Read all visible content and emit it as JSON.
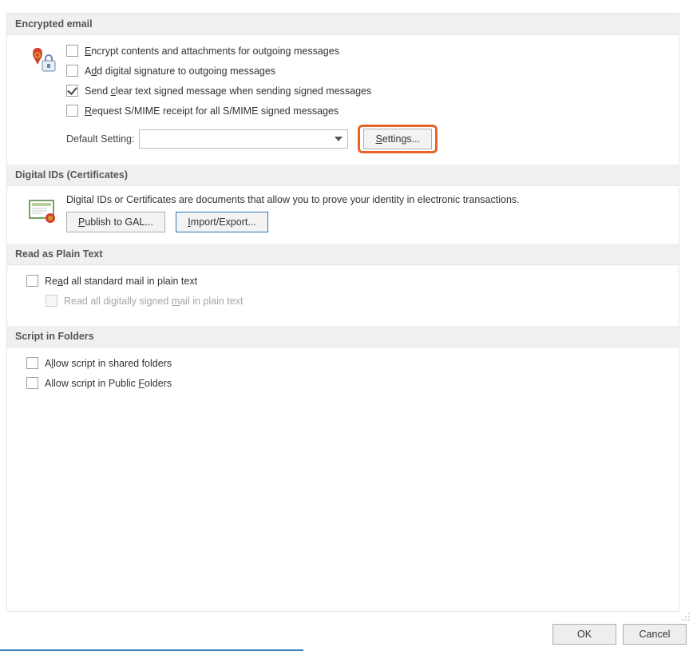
{
  "sections": {
    "encrypted": {
      "title": "Encrypted email",
      "cb_encrypt": "Encrypt contents and attachments for outgoing messages",
      "cb_signature": "Add digital signature to outgoing messages",
      "cb_cleartext": "Send clear text signed message when sending signed messages",
      "cb_receipt": "Request S/MIME receipt for all S/MIME signed messages",
      "default_label": "Default Setting:",
      "settings_btn": "Settings..."
    },
    "digitalids": {
      "title": "Digital IDs (Certificates)",
      "desc": "Digital IDs or Certificates are documents that allow you to prove your identity in electronic transactions.",
      "publish_btn": "Publish to GAL...",
      "import_btn": "Import/Export..."
    },
    "plaintext": {
      "title": "Read as Plain Text",
      "cb_all": "Read all standard mail in plain text",
      "cb_signed": "Read all digitally signed mail in plain text"
    },
    "script": {
      "title": "Script in Folders",
      "cb_shared": "Allow script in shared folders",
      "cb_public": "Allow script in Public Folders"
    }
  },
  "footer": {
    "ok": "OK",
    "cancel": "Cancel"
  }
}
